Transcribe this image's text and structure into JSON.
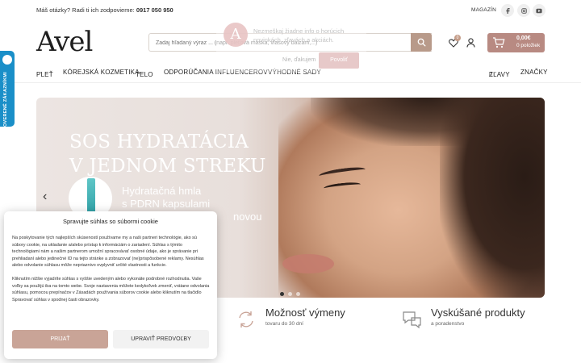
{
  "topbar": {
    "help_text": "Máš otázky? Radi ti ich zodpovieme:",
    "phone": "0917 050 950",
    "shop_label": "MAGAZÍN",
    "social_icons": [
      "facebook-icon",
      "instagram-icon",
      "youtube-icon"
    ]
  },
  "header": {
    "logo_text": "Avel",
    "search_placeholder": "Zadaj hľadaný výraz ... (napr. pleťová maska, vlasový balzam,...)",
    "cart_total": "0,00€",
    "cart_items": "0 položiek",
    "wishlist_count": "0"
  },
  "nav": {
    "items": [
      "PLEŤ",
      "KÓREJSKÁ KOZMETIKA",
      "TELO",
      "ODPORÚČANIA INFLUENCEROV",
      "VÝHODNÉ SADY"
    ],
    "right_items": [
      "ZĽAVY",
      "ZNAČKY"
    ]
  },
  "side_tab": {
    "label": "OVERENÉ ZÁKAZNÍKMI"
  },
  "push_prompt": {
    "avatar_letter": "A",
    "message": "Nezmeškaj žiadne info o horúcich novinkách, zľavách a akciách.",
    "decline": "Nie, ďakujem",
    "accept": "Povoliť"
  },
  "hero": {
    "headline_line1": "SOS HYDRATÁCIA",
    "headline_line2": "V JEDNOM STREKU",
    "sub_line1": "Hydratačná hmla",
    "sub_line2": "s PDRN kapsulami",
    "sub_line3": "novou",
    "slide_count": 3,
    "active_slide": 1
  },
  "features": [
    {
      "title": "Možnosť výmeny",
      "subtitle": "tovaru do 30 dní",
      "icon": "exchange-icon"
    },
    {
      "title": "Vyskúšané produkty",
      "subtitle": "a poradenstvo",
      "icon": "chat-icon"
    }
  ],
  "cookie": {
    "title": "Spravujte súhlas so súbormi cookie",
    "paragraph1": "Na poskytovanie tých najlepších skúseností používame my a naši partneri technológie, ako sú súbory cookie, na ukladanie a/alebo prístup k informáciám o zariadení. Súhlas s týmito technológiami nám a našim partnerom umožní spracovávať osobné údaje, ako je správanie pri prehliadaní alebo jedinečné ID na tejto stránke a zobrazovať (ne)prispôsobené reklamy. Nesúhlas alebo odvolanie súhlasu môže nepriaznivo ovplyvniť určité vlastnosti a funkcie.",
    "paragraph2": "Kliknutím nižšie vyjadríte súhlas s vyššie uvedeným alebo vykonáte podrobné rozhodnutia. Vaše voľby sa použijú iba na tomto webe. Svoje nastavenia môžete kedykoľvek zmeniť, vrátane odvolania súhlasu, pomocou prepínačov v Zásadách používania súborov cookie alebo kliknutím na tlačidlo Spravovať súhlas v spodnej časti obrazovky.",
    "accept_label": "PRIJAŤ",
    "prefs_label": "UPRAVIŤ PREDVOĽBY"
  },
  "colors": {
    "accent": "#b89a8a",
    "cart": "#b88a82",
    "side_tab": "#1a8fc8",
    "cookie_accept": "#c9a497"
  }
}
